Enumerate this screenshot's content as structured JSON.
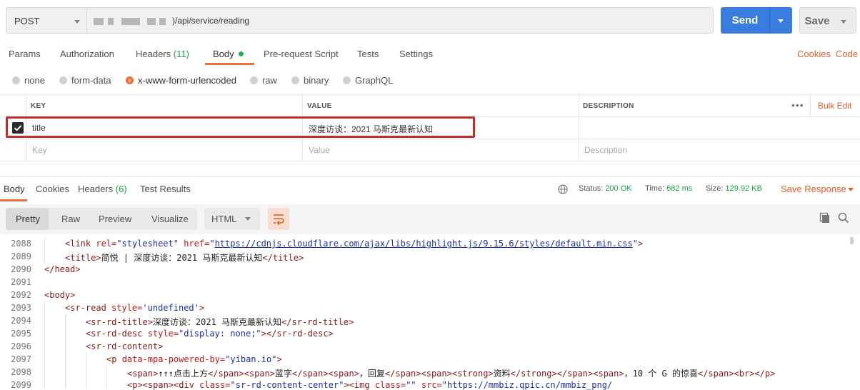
{
  "request": {
    "method": "POST",
    "url_visible": ")/api/service/reading",
    "send_label": "Send",
    "save_label": "Save"
  },
  "tabs": [
    {
      "label": "Params"
    },
    {
      "label": "Authorization"
    },
    {
      "label": "Headers",
      "count": "(11)"
    },
    {
      "label": "Body",
      "active": true
    },
    {
      "label": "Pre-request Script"
    },
    {
      "label": "Tests"
    },
    {
      "label": "Settings"
    }
  ],
  "right_links": {
    "cookies": "Cookies",
    "code": "Code"
  },
  "body_types": [
    "none",
    "form-data",
    "x-www-form-urlencoded",
    "raw",
    "binary",
    "GraphQL"
  ],
  "body_type_selected": "x-www-form-urlencoded",
  "table": {
    "headers": {
      "key": "KEY",
      "value": "VALUE",
      "description": "DESCRIPTION"
    },
    "more_icon": "more-horizontal-icon",
    "bulk_edit": "Bulk Edit",
    "rows": [
      {
        "checked": true,
        "key": "title",
        "value": "深度访谈：2021 马斯克最新认知",
        "description": ""
      }
    ],
    "placeholders": {
      "key": "Key",
      "value": "Value",
      "description": "Description"
    }
  },
  "response": {
    "tabs": [
      {
        "label": "Body",
        "active": true
      },
      {
        "label": "Cookies"
      },
      {
        "label": "Headers",
        "count": "(6)"
      },
      {
        "label": "Test Results"
      }
    ],
    "status_label": "Status:",
    "status_value": "200 OK",
    "time_label": "Time:",
    "time_value": "682 ms",
    "size_label": "Size:",
    "size_value": "129.92 KB",
    "save_response": "Save Response",
    "views": [
      "Pretty",
      "Raw",
      "Preview",
      "Visualize"
    ],
    "view_selected": "Pretty",
    "language": "HTML",
    "colors": {
      "accent": "#f26b3a",
      "send": "#3a7de0",
      "ok": "#16a34a"
    }
  },
  "code_lines": [
    {
      "n": "2088"
    },
    {
      "n": "2089"
    },
    {
      "n": "2090"
    },
    {
      "n": "2091"
    },
    {
      "n": "2092"
    },
    {
      "n": "2093"
    },
    {
      "n": "2094"
    },
    {
      "n": "2095"
    },
    {
      "n": "2096"
    },
    {
      "n": "2097"
    },
    {
      "n": "2098"
    },
    {
      "n": "2099"
    }
  ],
  "code": {
    "l2088_a": "<link ",
    "l2088_b": "rel=",
    "l2088_c": "\"stylesheet\"",
    "l2088_d": " href=",
    "l2088_e": "\"",
    "l2088_f": "https://cdnjs.cloudflare.com/ajax/libs/highlight.js/9.15.6/styles/default.min.css",
    "l2088_g": "\"",
    "l2088_h": ">",
    "l2089_a": "<title>",
    "l2089_b": "简悦 | 深度访谈：2021 马斯克最新认知",
    "l2089_c": "</title>",
    "l2090": "</head>",
    "l2092": "<body>",
    "l2093_a": "<sr-read ",
    "l2093_b": "style=",
    "l2093_c": "'undefined'",
    "l2093_d": ">",
    "l2094_a": "<sr-rd-title>",
    "l2094_b": "深度访谈：2021 马斯克最新认知",
    "l2094_c": "</sr-rd-title>",
    "l2095_a": "<sr-rd-desc ",
    "l2095_b": "style=",
    "l2095_c": "\"display: none;\"",
    "l2095_d": "></sr-rd-desc>",
    "l2096": "<sr-rd-content>",
    "l2097_a": "<p ",
    "l2097_b": "data-mpa-powered-by=",
    "l2097_c": "\"yiban.io\"",
    "l2097_d": ">",
    "l2098_a": "<span>",
    "l2098_b": "↑↑↑点击上方",
    "l2098_c": "</span><span>",
    "l2098_d": "蓝字",
    "l2098_e": "</span><span>",
    "l2098_f": "，回复",
    "l2098_g": "</span><span><strong>",
    "l2098_h": "资料",
    "l2098_i": "</strong></span><span>",
    "l2098_j": "，10 个 G 的惊喜",
    "l2098_k": "</span><br></p>",
    "l2099_a": "<p><span><div ",
    "l2099_b": "class=",
    "l2099_c": "\"sr-rd-content-center\"",
    "l2099_d": "><img ",
    "l2099_e": "class=",
    "l2099_f": "\"\"",
    "l2099_g": " src=",
    "l2099_h": "\"https://mmbiz.qpic.cn/mmbiz_png/"
  }
}
